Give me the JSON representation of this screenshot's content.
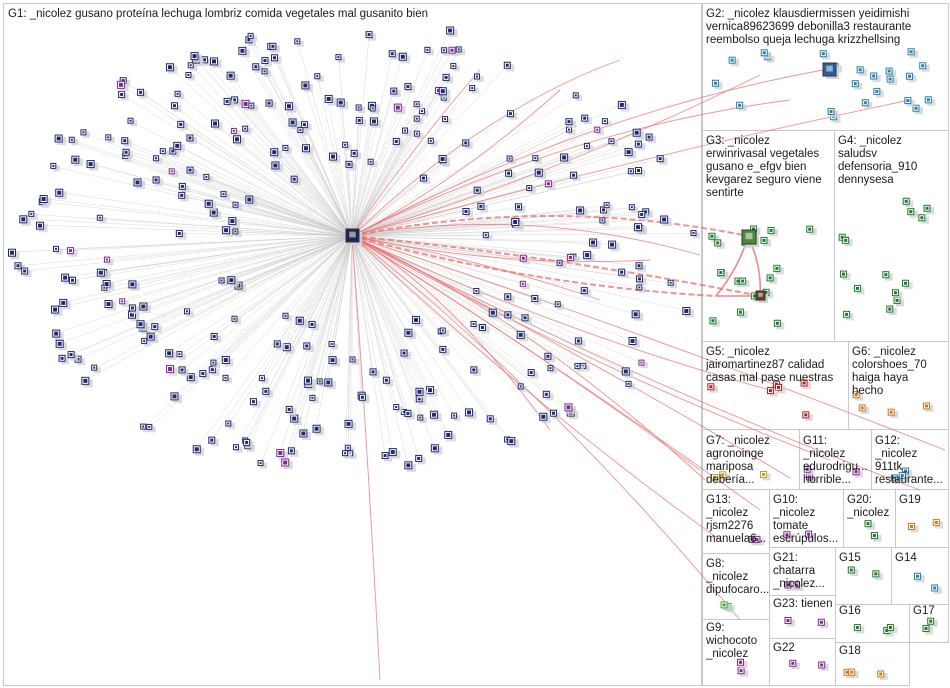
{
  "groups": [
    {
      "id": "G1",
      "label": "G1: _nicolez gusano proteína lechuga lombriz comida vegetales mal gusanito bien"
    },
    {
      "id": "G2",
      "label": "G2: _nicolez klausdiermissen yeidimishi\nvernica89623699 debonilla3 restaurante\nreembolso queja lechuga krizzhellsing"
    },
    {
      "id": "G3",
      "label": "G3: _nicolez\nerwinrivasal vegetales\ngusano e_efgv bien\nkevgarez seguro viene\nsentirte"
    },
    {
      "id": "G4",
      "label": "G4: _nicolez\nsaludsv\ndefensoria_910\ndennysesa"
    },
    {
      "id": "G5",
      "label": "G5: _nicolez\njairomartinez87 calidad\ncasas mal pase nuestras"
    },
    {
      "id": "G6",
      "label": "G6: _nicolez\ncolorshoes_70\nhaiga haya\nhecho"
    },
    {
      "id": "G7",
      "label": "G7: _nicolez\nagronoinge\nmariposa\ndebería..."
    },
    {
      "id": "G11",
      "label": "G11:\n_nicolez\nedurodrigu...\nhorrible..."
    },
    {
      "id": "G12",
      "label": "G12:\n_nicolez\n911tk_\nrestaurante..."
    },
    {
      "id": "G13",
      "label": "G13:\n_nicolez\nrjsm2276\nmanuela6..."
    },
    {
      "id": "G10",
      "label": "G10:\n_nicolez\ntomate\nescrúpulos..."
    },
    {
      "id": "G20",
      "label": "G20:\n_nicolez"
    },
    {
      "id": "G19",
      "label": "G19"
    },
    {
      "id": "G8",
      "label": "G8:\n_nicolez\ndipufocaro..."
    },
    {
      "id": "G21",
      "label": "G21:\nchatarra\n_nicolez..."
    },
    {
      "id": "G15",
      "label": "G15"
    },
    {
      "id": "G14",
      "label": "G14"
    },
    {
      "id": "G23",
      "label": "G23: tienen"
    },
    {
      "id": "G16",
      "label": "G16"
    },
    {
      "id": "G17",
      "label": "G17"
    },
    {
      "id": "G9",
      "label": "G9:\nwichocoto\n_nicolez"
    },
    {
      "id": "G22",
      "label": "G22"
    },
    {
      "id": "G18",
      "label": "G18"
    }
  ],
  "colors": {
    "panel_border": "#c8c8c8",
    "edge_gray": "#c4c4c4",
    "edge_red": "#ee6c6c",
    "node_navy": "#1f2a6e",
    "node_green": "#1e7a30",
    "node_teal": "#2b7fa8",
    "node_purple": "#7b2b8c",
    "node_orange": "#c87a20",
    "node_shadow": "#d2d2d2"
  }
}
